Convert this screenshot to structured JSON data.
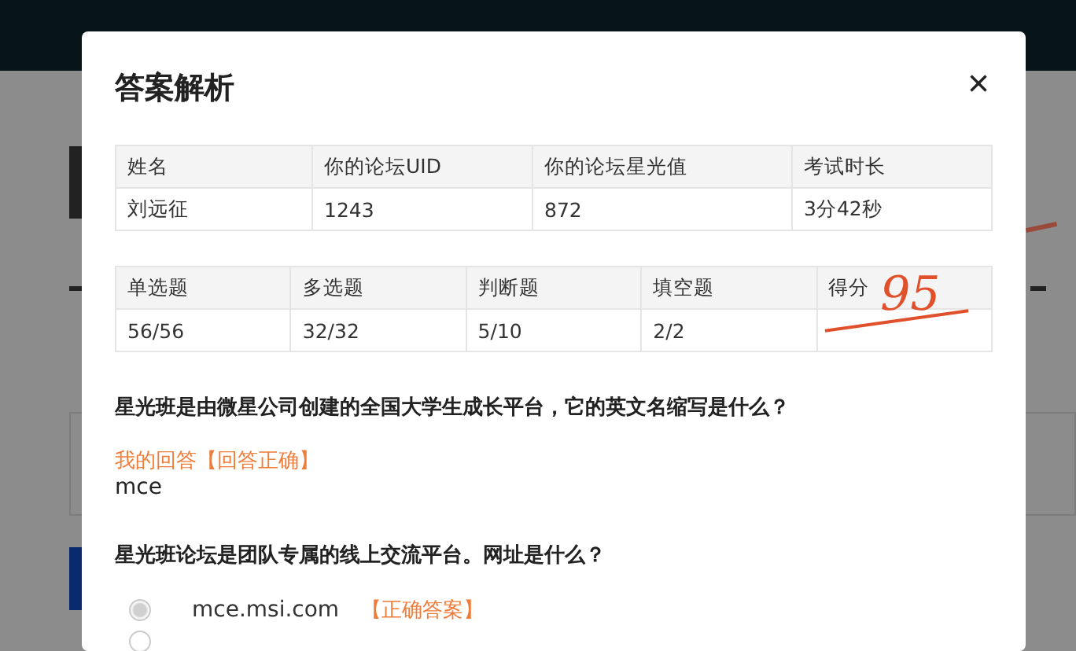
{
  "dialog": {
    "title": "答案解析",
    "close": "×"
  },
  "info_table": {
    "columns": [
      "姓名",
      "你的论坛UID",
      "你的论坛星光值",
      "考试时长"
    ],
    "rows": [
      [
        "刘远征",
        "1243",
        "872",
        "3分42秒"
      ]
    ]
  },
  "score_table": {
    "columns": [
      "单选题",
      "多选题",
      "判断题",
      "填空题",
      "得分"
    ],
    "rows": [
      [
        "56/56",
        "32/32",
        "5/10",
        "2/2",
        ""
      ]
    ],
    "handwritten_score": "95"
  },
  "questions": [
    {
      "kind": "text",
      "question": "星光班是由微星公司创建的全国大学生成长平台，它的英文名缩写是什么？",
      "answer_label": "我的回答【回答正确】",
      "answer": "mce"
    },
    {
      "kind": "choice",
      "question": "星光班论坛是团队专属的线上交流平台。网址是什么？",
      "options": [
        {
          "text": "mce.msi.com",
          "tag": "【正确答案】",
          "selected": true
        },
        {
          "selected": false
        }
      ]
    }
  ]
}
